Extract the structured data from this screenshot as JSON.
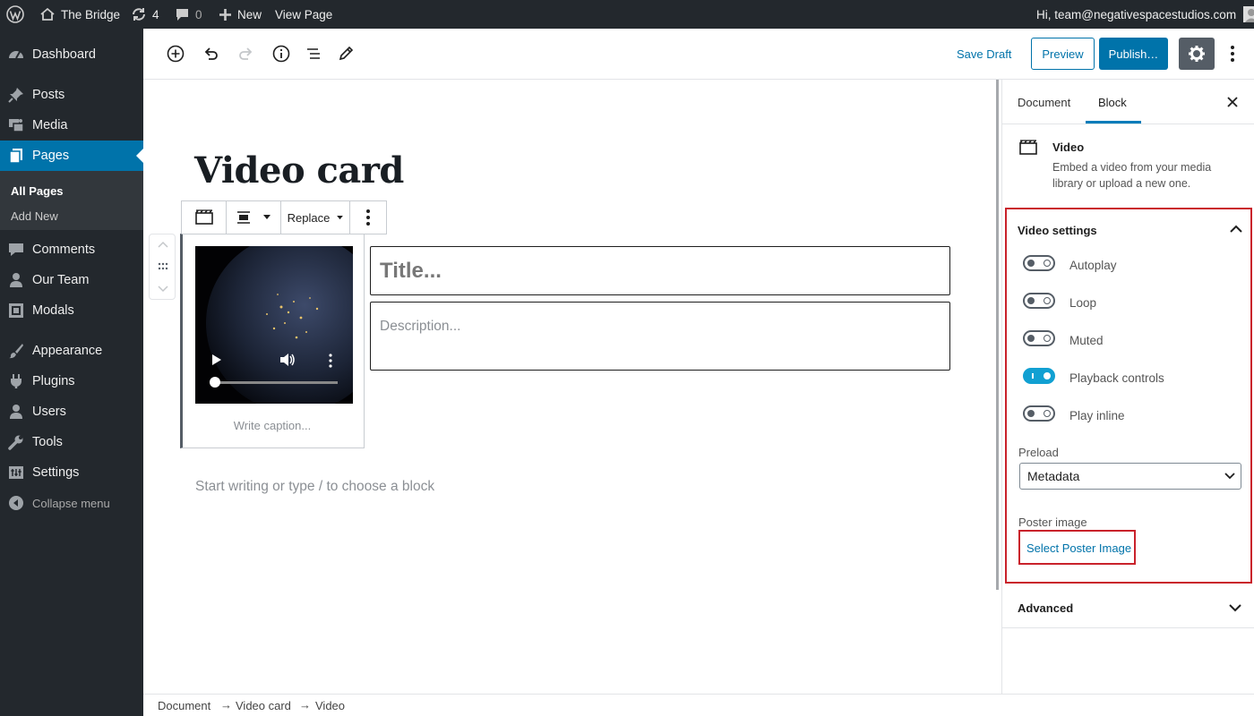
{
  "admin_bar": {
    "site_name": "The Bridge",
    "updates_count": "4",
    "comments_count": "0",
    "new_label": "New",
    "view_page_label": "View Page",
    "greeting": "Hi, team@negativespacestudios.com"
  },
  "sidebar": {
    "items": [
      {
        "label": "Dashboard",
        "icon": "dashboard-icon"
      },
      {
        "label": "Posts",
        "icon": "pin-icon"
      },
      {
        "label": "Media",
        "icon": "media-icon"
      },
      {
        "label": "Pages",
        "icon": "pages-icon"
      },
      {
        "label": "Comments",
        "icon": "comment-icon"
      },
      {
        "label": "Our Team",
        "icon": "user-icon"
      },
      {
        "label": "Modals",
        "icon": "modal-icon"
      },
      {
        "label": "Appearance",
        "icon": "brush-icon"
      },
      {
        "label": "Plugins",
        "icon": "plugin-icon"
      },
      {
        "label": "Users",
        "icon": "users-icon"
      },
      {
        "label": "Tools",
        "icon": "wrench-icon"
      },
      {
        "label": "Settings",
        "icon": "settings-icon"
      }
    ],
    "submenu": [
      "All Pages",
      "Add New"
    ],
    "collapse_label": "Collapse menu"
  },
  "toolbar": {
    "save_draft": "Save Draft",
    "preview": "Preview",
    "publish": "Publish…"
  },
  "editor": {
    "title": "Video card",
    "replace_label": "Replace",
    "card_title_placeholder": "Title...",
    "card_description_placeholder": "Description...",
    "caption_placeholder": "Write caption...",
    "block_appender_placeholder": "Start writing or type / to choose a block"
  },
  "settings_panel": {
    "tab_document": "Document",
    "tab_block": "Block",
    "block_name": "Video",
    "block_description": "Embed a video from your media library or upload a new one.",
    "video_settings_title": "Video settings",
    "toggles": [
      {
        "label": "Autoplay",
        "on": false
      },
      {
        "label": "Loop",
        "on": false
      },
      {
        "label": "Muted",
        "on": false
      },
      {
        "label": "Playback controls",
        "on": true
      },
      {
        "label": "Play inline",
        "on": false
      }
    ],
    "preload_label": "Preload",
    "preload_value": "Metadata",
    "poster_label": "Poster image",
    "select_poster": "Select Poster Image",
    "advanced_title": "Advanced"
  },
  "breadcrumb": [
    "Document",
    "Video card",
    "Video"
  ],
  "colors": {
    "admin_dark": "#23282d",
    "wp_blue": "#0073aa",
    "toggle_on": "#11a0d2",
    "highlight_red": "#c9222b"
  }
}
